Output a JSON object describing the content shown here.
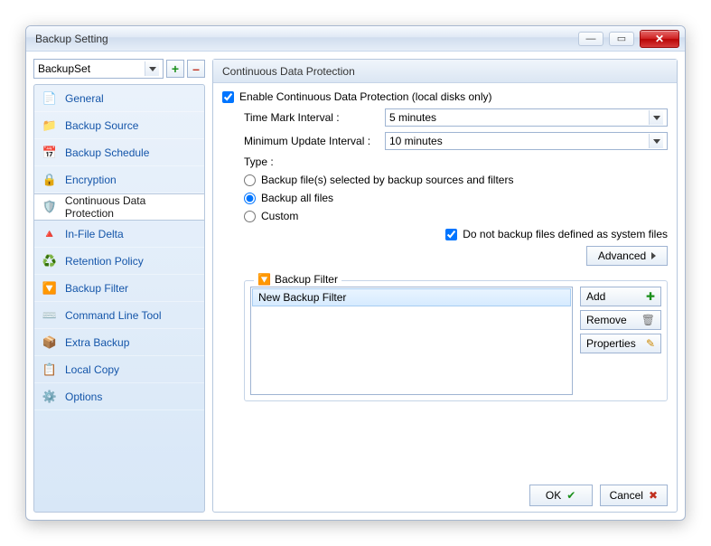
{
  "window": {
    "title": "Backup Setting"
  },
  "backupset": {
    "name": "BackupSet"
  },
  "sidebar": {
    "items": [
      {
        "label": "General",
        "icon": "📄"
      },
      {
        "label": "Backup Source",
        "icon": "📁"
      },
      {
        "label": "Backup Schedule",
        "icon": "📅"
      },
      {
        "label": "Encryption",
        "icon": "🔒"
      },
      {
        "label": "Continuous Data Protection",
        "icon": "🛡️"
      },
      {
        "label": "In-File Delta",
        "icon": "🔺"
      },
      {
        "label": "Retention Policy",
        "icon": "♻️"
      },
      {
        "label": "Backup Filter",
        "icon": "🔽"
      },
      {
        "label": "Command Line Tool",
        "icon": "⌨️"
      },
      {
        "label": "Extra Backup",
        "icon": "📦"
      },
      {
        "label": "Local Copy",
        "icon": "📋"
      },
      {
        "label": "Options",
        "icon": "⚙️"
      }
    ]
  },
  "panel": {
    "title": "Continuous Data Protection",
    "enable_label": "Enable Continuous Data Protection (local disks only)",
    "time_mark_label": "Time Mark Interval :",
    "time_mark_value": "5 minutes",
    "min_update_label": "Minimum Update Interval :",
    "min_update_value": "10 minutes",
    "type_label": "Type :",
    "type_options": [
      "Backup file(s) selected by backup sources and filters",
      "Backup all files",
      "Custom"
    ],
    "system_files_label": "Do not backup files defined as system files",
    "advanced_label": "Advanced"
  },
  "filter_group": {
    "title": "Backup Filter",
    "item": "New Backup Filter",
    "add": "Add",
    "remove": "Remove",
    "properties": "Properties"
  },
  "footer": {
    "ok": "OK",
    "cancel": "Cancel"
  }
}
